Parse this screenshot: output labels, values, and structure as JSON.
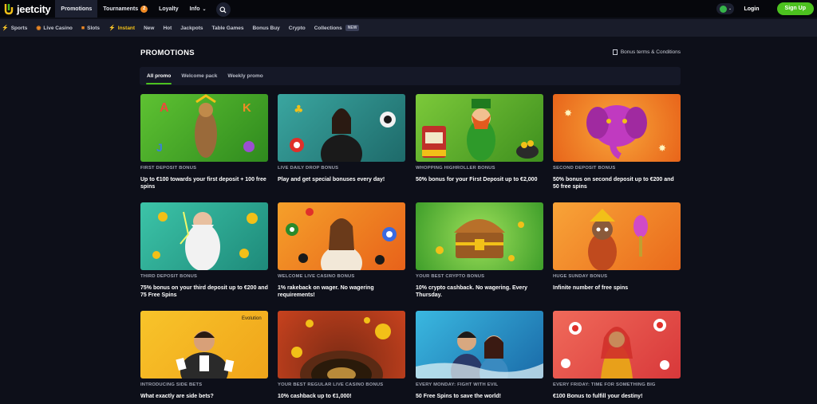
{
  "header": {
    "logo": "jeetcity",
    "nav": [
      {
        "label": "Promotions",
        "active": true
      },
      {
        "label": "Tournaments",
        "badge": "2"
      },
      {
        "label": "Loyalty"
      },
      {
        "label": "Info"
      }
    ],
    "login_label": "Login",
    "signup_label": "Sign Up"
  },
  "categories": [
    {
      "label": "Sports",
      "icon": "ball-icon"
    },
    {
      "label": "Live Casino",
      "icon": "live-icon"
    },
    {
      "label": "Slots",
      "icon": "slots-icon"
    },
    {
      "label": "Instant",
      "icon": "bolt-icon",
      "highlight": true
    },
    {
      "label": "New"
    },
    {
      "label": "Hot"
    },
    {
      "label": "Jackpots"
    },
    {
      "label": "Table Games"
    },
    {
      "label": "Bonus Buy"
    },
    {
      "label": "Crypto"
    },
    {
      "label": "Collections",
      "tag": "NEW"
    }
  ],
  "page": {
    "title": "PROMOTIONS",
    "terms_label": "Bonus terms & Conditions",
    "tabs": [
      {
        "label": "All promo",
        "active": true
      },
      {
        "label": "Welcome pack"
      },
      {
        "label": "Weekly promo"
      }
    ]
  },
  "promos": [
    {
      "label": "FIRST DEPOSIT BONUS",
      "desc": "Up to €100 towards your first deposit + 100 free spins",
      "color": "#3fa12a"
    },
    {
      "label": "LIVE DAILY DROP BONUS",
      "desc": "Play and get special bonuses every day!",
      "color": "#2f8f8a"
    },
    {
      "label": "WHOPPING HIGHROLLER BONUS",
      "desc": "50% bonus for your First Deposit up to €2,000",
      "color": "#5fb22d"
    },
    {
      "label": "SECOND DEPOSIT BONUS",
      "desc": "50% bonus on second deposit up to €200 and 50 free spins",
      "color": "#f07a18"
    },
    {
      "label": "THIRD DEPOSIT BONUS",
      "desc": "75% bonus on your third deposit up to €200 and 75 Free Spins",
      "color": "#2fb39b"
    },
    {
      "label": "WELCOME LIVE CASINO BONUS",
      "desc": "1% rakeback on wager. No wagering requirements!",
      "color": "#f28a1c"
    },
    {
      "label": "YOUR BEST CRYPTO BONUS",
      "desc": "10% crypto cashback. No wagering. Every Thursday.",
      "color": "#5cc34a"
    },
    {
      "label": "HUGE SUNDAY BONUS",
      "desc": "Infinite number of free spins",
      "color": "#f48a22"
    },
    {
      "label": "INTRODUCING SIDE BETS",
      "desc": "What exactly are side bets?",
      "color": "#f2b41e",
      "brand": "Evolution"
    },
    {
      "label": "YOUR BEST REGULAR LIVE CASINO BONUS",
      "desc": "10% cashback up to €1,000!",
      "color": "#b8321e"
    },
    {
      "label": "EVERY MONDAY: FIGHT WITH EVIL",
      "desc": "50 Free Spins to save the world!",
      "color": "#2a9cc4"
    },
    {
      "label": "EVERY FRIDAY: TIME FOR SOMETHING BIG",
      "desc": "€100 Bonus to fulfill your destiny!",
      "color": "#e8504c"
    }
  ]
}
